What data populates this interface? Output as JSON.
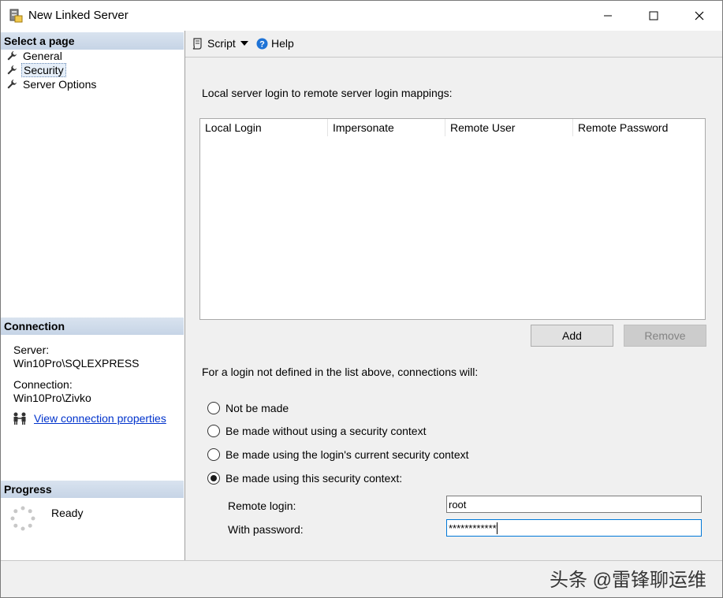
{
  "window": {
    "title": "New Linked Server"
  },
  "left": {
    "select_page_header": "Select a page",
    "nav": [
      {
        "label": "General"
      },
      {
        "label": "Security"
      },
      {
        "label": "Server Options"
      }
    ],
    "connection_header": "Connection",
    "server_label": "Server:",
    "server_value": "Win10Pro\\SQLEXPRESS",
    "connection_label": "Connection:",
    "connection_value": "Win10Pro\\Zivko",
    "view_link": "View connection properties",
    "progress_header": "Progress",
    "progress_status": "Ready"
  },
  "toolbar": {
    "script_label": "Script",
    "help_label": "Help"
  },
  "security": {
    "mappings_label": "Local server login to remote server login mappings:",
    "columns": [
      "Local Login",
      "Impersonate",
      "Remote User",
      "Remote Password"
    ],
    "add_label": "Add",
    "remove_label": "Remove",
    "fallback_label": "For a login not defined in the list above, connections will:",
    "options": [
      {
        "label": "Not be made",
        "checked": false
      },
      {
        "label": "Be made without using a security context",
        "checked": false
      },
      {
        "label": "Be made using the login's current security context",
        "checked": false
      },
      {
        "label": "Be made using this security context:",
        "checked": true
      }
    ],
    "remote_login_label": "Remote login:",
    "remote_login_value": "root",
    "password_label": "With password:",
    "password_value": "************"
  },
  "watermark": {
    "text": "头条 @雷锋聊运维"
  }
}
